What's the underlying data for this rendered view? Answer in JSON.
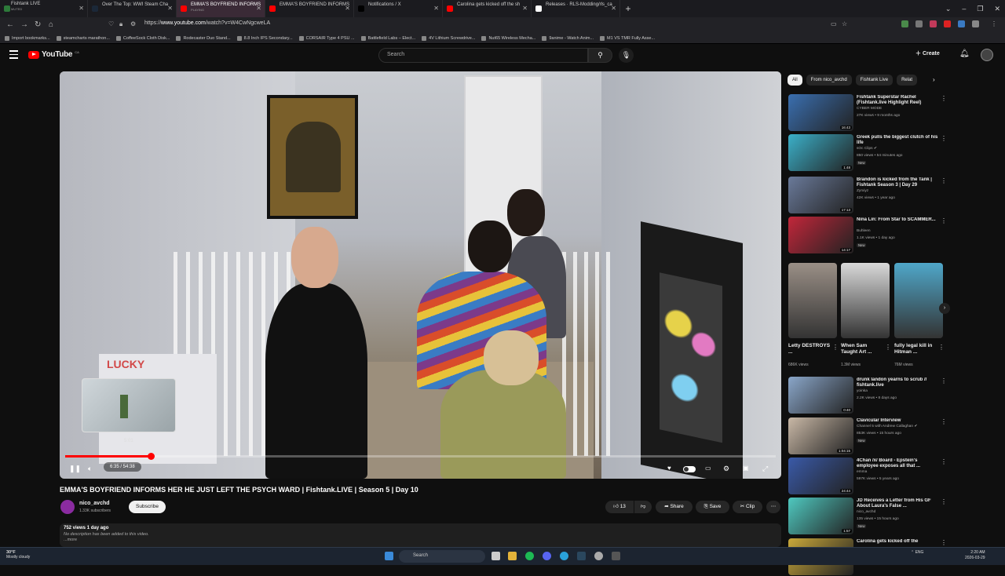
{
  "browser": {
    "tabs": [
      {
        "title": "Fishtank LIVE",
        "sub": "MUTED",
        "color": "#2d7a3a"
      },
      {
        "title": "Over The Top: WWI Steam Cha",
        "sub": "",
        "color": "#1b2838"
      },
      {
        "title": "EMMA'S BOYFRIEND INFORMS",
        "sub": "PLAYING",
        "color": "#ff0000"
      },
      {
        "title": "EMMA'S BOYFRIEND INFORMS",
        "sub": "",
        "color": "#ff0000"
      },
      {
        "title": "Notifications / X",
        "sub": "",
        "color": "#000000"
      },
      {
        "title": "Carolina gets kicked off the sh",
        "sub": "",
        "color": "#ff0000"
      },
      {
        "title": "Releases · RLS-Modding/rls_ca",
        "sub": "",
        "color": "#ffffff"
      }
    ],
    "url_prefix": "https://",
    "url_host": "www.youtube.com",
    "url_path": "/watch?v=W4CwNgcweLA",
    "bookmarks": [
      "Import bookmarks...",
      "steamcharts marathon...",
      "CoffeeSock Cloth Disk...",
      "Rodecaster Duo Stand...",
      "8.8 Inch IPS Secondary...",
      "CORSAIR Type 4 PSU ...",
      "Battlefield Labs – Elect...",
      "4V Lithium Screwdrive...",
      "Nut65 Wireless Mecha...",
      "9anime - Watch Anim...",
      "M1 VS TMR Fully Asse..."
    ]
  },
  "youtube": {
    "logo": "YouTube",
    "country": "CA",
    "search_placeholder": "Search",
    "create_label": "Create"
  },
  "video": {
    "title": "EMMA'S BOYFRIEND INFORMS HER HE JUST LEFT THE PSYCH WARD | Fishtank.LIVE | Season 5 | Day 10",
    "poster_text": "LUCKY",
    "preview_time": "5:01",
    "time_display": "6:35 / 54:38",
    "progress_fraction": 0.1205,
    "channel": "nico_avchd",
    "subscribers": "1.33K subscribers",
    "subscribe_label": "Subscribe",
    "likes": "13",
    "share_label": "Share",
    "save_label": "Save",
    "clip_label": "Clip",
    "meta": "752 views  1 day ago",
    "description": "No description has been added to this video.",
    "more": "...more"
  },
  "sidebar": {
    "chips": [
      "All",
      "From nico_avchd",
      "Fishtank Live",
      "Relat"
    ],
    "recs_top": [
      {
        "title": "Fishtank Superstar Rachel (Fishtank.live Highlight Reel)",
        "channel": "CYBER MODE",
        "views": "27K views • 9 months ago",
        "duration": "16:43",
        "badge": "",
        "thumb": "#3a6fb0"
      },
      {
        "title": "Greek pulls the biggest clutch of his life",
        "channel": "sOc Clips ✔",
        "views": "850 views • 54 minutes ago",
        "duration": "1:48",
        "badge": "New",
        "thumb": "#3bb0c9"
      },
      {
        "title": "Brandon is kicked from the Tank | Fishtank Season 3 | Day 29",
        "channel": "Zyrxiyz",
        "views": "42K views • 1 year ago",
        "duration": "17:13",
        "badge": "",
        "thumb": "#6a7a9a"
      },
      {
        "title": "Nina Lin: From Star to SCAMMER...",
        "channel": "Buhleen",
        "views": "1.1K views • 1 day ago",
        "duration": "14:17",
        "badge": "New",
        "thumb": "#c2263a"
      }
    ],
    "shorts": [
      {
        "title": "Letty DESTROYS ...",
        "views": "686K views",
        "thumb": "#9a8f86"
      },
      {
        "title": "When Sam Taught Art ...",
        "views": "1.3M views",
        "thumb": "#d9d9d9"
      },
      {
        "title": "fully legal kill in Hitman ...",
        "views": "76M views",
        "thumb": "#4fa7c9"
      }
    ],
    "recs_bottom": [
      {
        "title": "drunk landon yearns to scrub // fishtank.live",
        "channel": "yoinka",
        "views": "2.2K views • 8 days ago",
        "duration": "0:40",
        "badge": "",
        "thumb": "#8aa6c9"
      },
      {
        "title": "Clavicular Interview",
        "channel": "Channel 5 with Andrew Callaghan ✔",
        "views": "853K views • 15 hours ago",
        "duration": "1:04:15",
        "badge": "New",
        "thumb": "#c9b8a6"
      },
      {
        "title": "4Chan /x/ Board - Epstein's employee exposes all that ...",
        "channel": "emma",
        "views": "597K views • 5 years ago",
        "duration": "24:44",
        "badge": "",
        "thumb": "#3a5aa8"
      },
      {
        "title": "JD Receives a Letter from His GF About Laura's False ...",
        "channel": "nico_avchd",
        "views": "135 views • 15 hours ago",
        "duration": "1:57",
        "badge": "New",
        "thumb": "#4fc9c0"
      },
      {
        "title": "Carolina gets kicked off the",
        "channel": "",
        "views": "",
        "duration": "",
        "badge": "",
        "thumb": "#c9a83a"
      }
    ]
  },
  "taskbar": {
    "temp": "30°F",
    "weather": "Mostly cloudy",
    "search": "Search",
    "lang1": "ENG",
    "lang2": "US",
    "time": "2:20 AM",
    "date": "2026-03-29"
  }
}
